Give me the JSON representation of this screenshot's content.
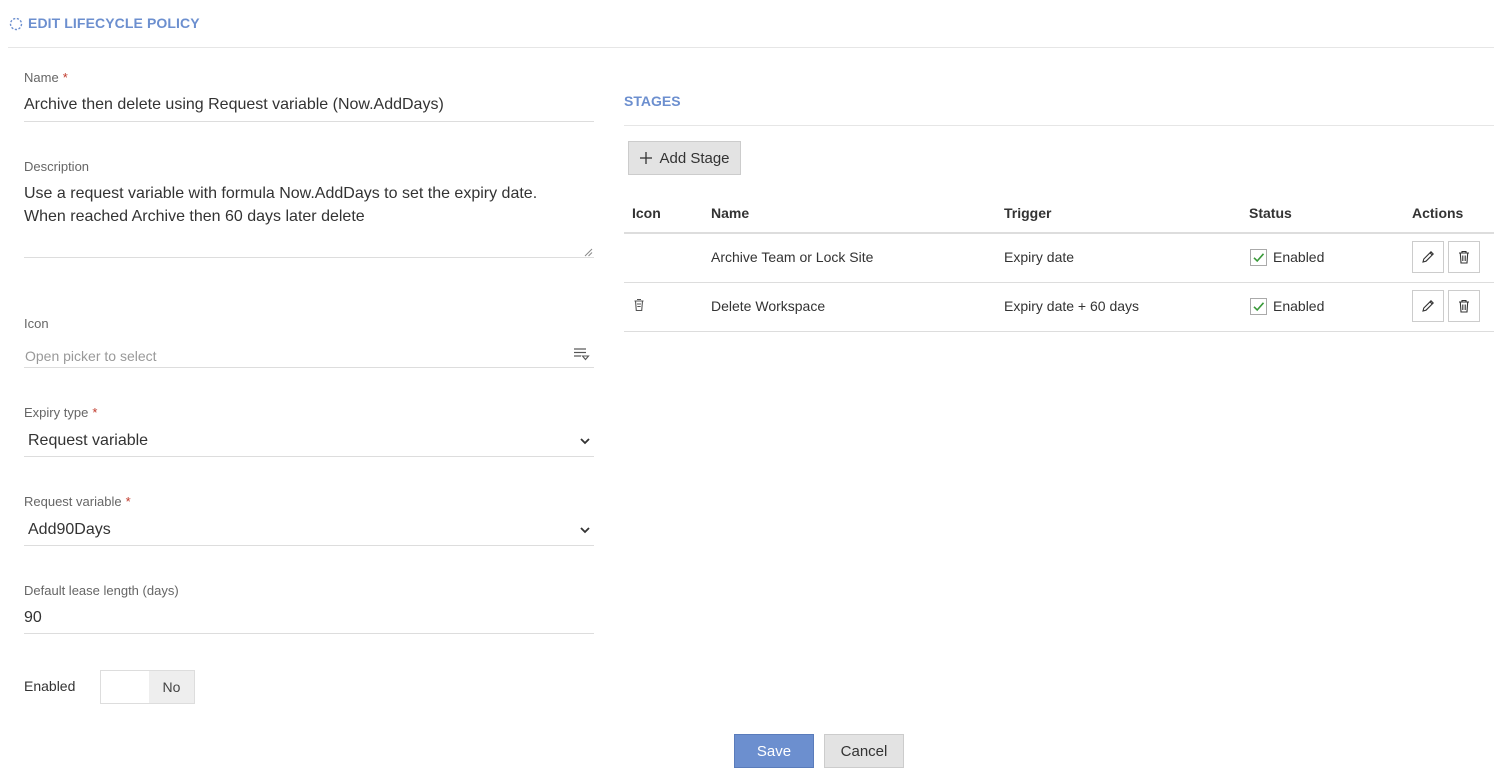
{
  "header": {
    "title": "EDIT LIFECYCLE POLICY",
    "icon": "spinner-icon",
    "accent_color": "#6c8fcf"
  },
  "form": {
    "name": {
      "label": "Name",
      "required_mark": "*",
      "value": "Archive then delete using Request variable (Now.AddDays)"
    },
    "description": {
      "label": "Description",
      "value_lines": [
        "Use a request variable with formula Now.AddDays to set the expiry date.",
        "When reached Archive then 60 days later delete"
      ]
    },
    "icon": {
      "label": "Icon",
      "placeholder": "Open picker to select",
      "picker_icon": "list-filter-icon"
    },
    "expiry_type": {
      "label": "Expiry type",
      "required_mark": "*",
      "value": "Request variable"
    },
    "request_variable": {
      "label": "Request variable",
      "required_mark": "*",
      "value": "Add90Days"
    },
    "lease_length": {
      "label": "Default lease length (days)",
      "value": "90"
    },
    "enabled": {
      "label": "Enabled",
      "toggle_text": "No"
    }
  },
  "stages": {
    "title": "STAGES",
    "add_button": "Add Stage",
    "columns": [
      "Icon",
      "Name",
      "Trigger",
      "Status",
      "Actions"
    ],
    "rows": [
      {
        "icon": "",
        "name": "Archive Team or Lock Site",
        "trigger": "Expiry date",
        "status": "Enabled",
        "checked": true
      },
      {
        "icon": "trash-bin-icon",
        "name": "Delete Workspace",
        "trigger": "Expiry date + 60 days",
        "status": "Enabled",
        "checked": true
      }
    ]
  },
  "buttons": {
    "save": "Save",
    "cancel": "Cancel"
  }
}
